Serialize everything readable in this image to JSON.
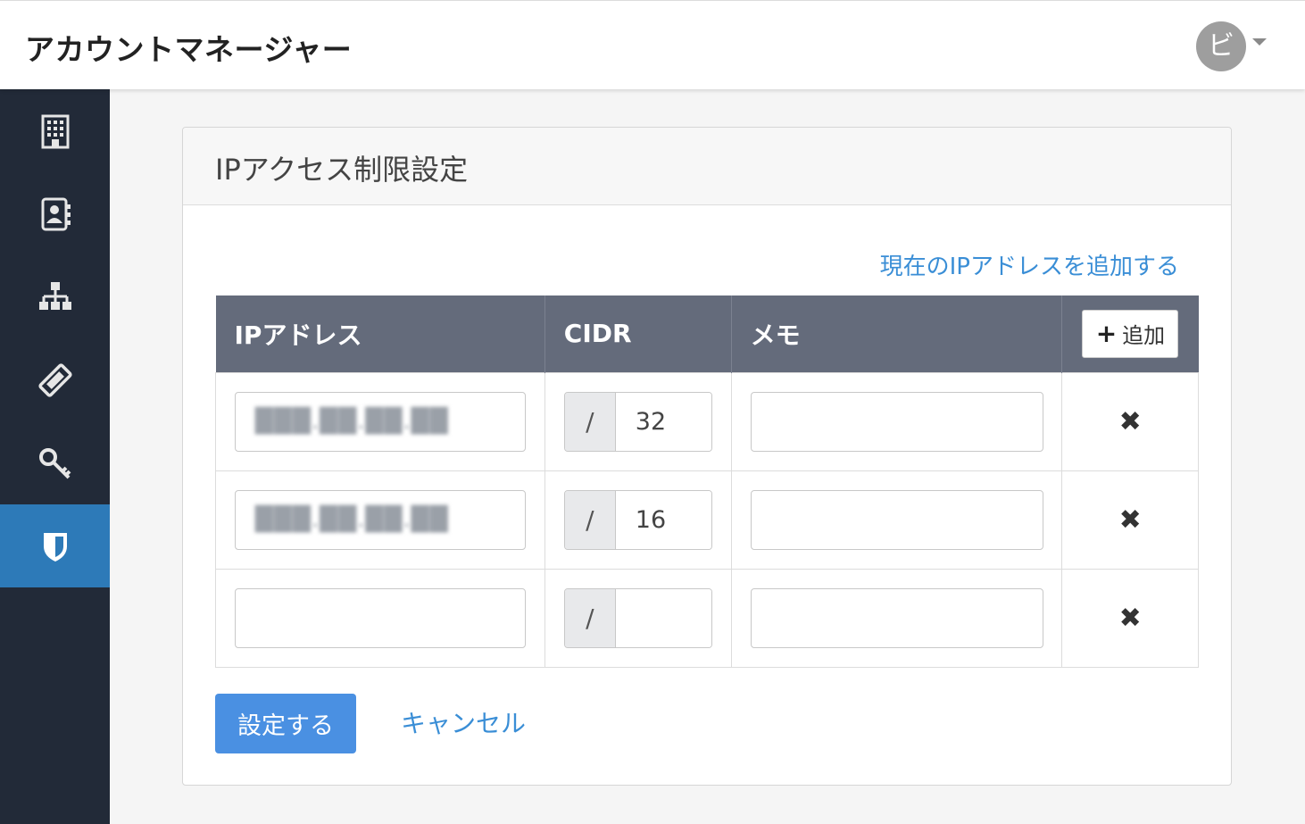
{
  "header": {
    "app_title": "アカウントマネージャー",
    "user_initial": "ビ"
  },
  "sidebar": {
    "items": [
      {
        "icon": "building-icon",
        "active": false
      },
      {
        "icon": "contact-book-icon",
        "active": false
      },
      {
        "icon": "org-chart-icon",
        "active": false
      },
      {
        "icon": "ticket-icon",
        "active": false
      },
      {
        "icon": "key-icon",
        "active": false
      },
      {
        "icon": "shield-icon",
        "active": true
      }
    ]
  },
  "panel": {
    "title": "IPアクセス制限設定",
    "add_current_ip_link": "現在のIPアドレスを追加する",
    "table": {
      "headers": {
        "ip": "IPアドレス",
        "cidr": "CIDR",
        "memo": "メモ",
        "add_button": "追加"
      },
      "cidr_prefix": "/",
      "rows": [
        {
          "ip": "███.██.██.██",
          "cidr": "32",
          "memo": ""
        },
        {
          "ip": "███.██.██.██",
          "cidr": "16",
          "memo": ""
        },
        {
          "ip": "",
          "cidr": "",
          "memo": ""
        }
      ],
      "delete_symbol": "✖"
    },
    "submit_label": "設定する",
    "cancel_label": "キャンセル"
  },
  "colors": {
    "sidebar_bg": "#222a38",
    "sidebar_active": "#2d7ab8",
    "table_header": "#646b7b",
    "primary": "#4a90e2",
    "link": "#3a8ed6"
  }
}
